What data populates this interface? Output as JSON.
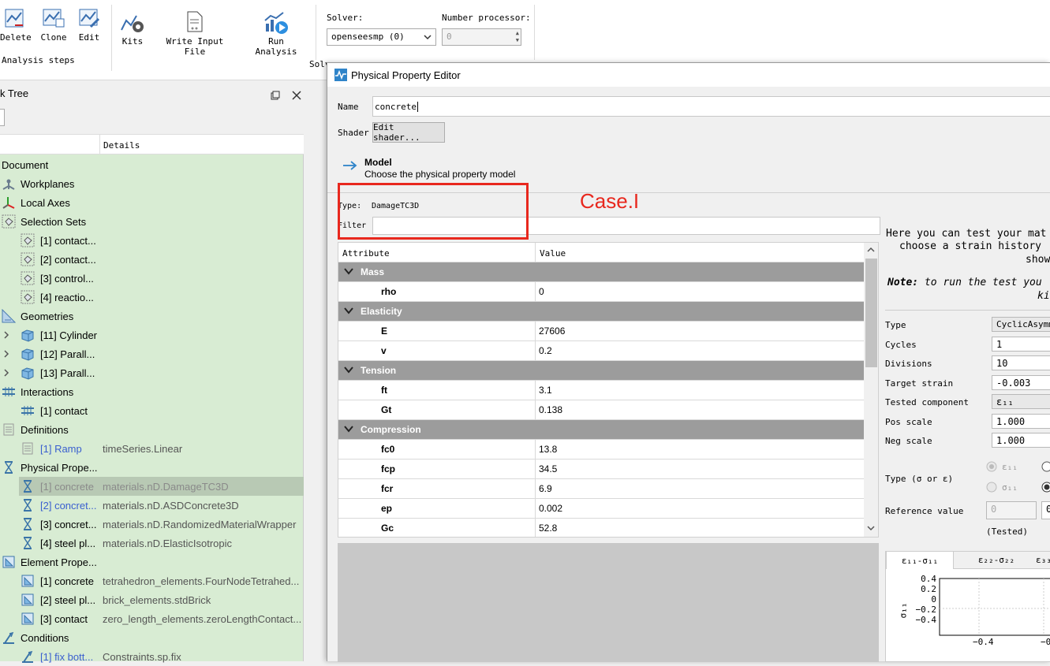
{
  "ribbon": {
    "delete_label": "Delete",
    "clone_label": "Clone",
    "edit_label": "Edit",
    "group_label": "Analysis steps",
    "kits_label": "Kits",
    "write_input_label": "Write Input File",
    "run_analysis_label": "Run Analysis",
    "solver_label": "Solver:",
    "solver_value": "openseesmp (0)",
    "nproc_label": "Number processor:",
    "nproc_value": "0",
    "solver_group_label": "Solv"
  },
  "tree": {
    "title": "k Tree",
    "details_header": "Details",
    "items": [
      {
        "label": "Document",
        "details": ""
      },
      {
        "label": "Workplanes",
        "details": ""
      },
      {
        "label": "Local Axes",
        "details": ""
      },
      {
        "label": "Selection Sets",
        "details": ""
      },
      {
        "label": "[1] contact...",
        "details": ""
      },
      {
        "label": "[2] contact...",
        "details": ""
      },
      {
        "label": "[3] control...",
        "details": ""
      },
      {
        "label": "[4] reactio...",
        "details": ""
      },
      {
        "label": "Geometries",
        "details": ""
      },
      {
        "label": "[11] Cylinder",
        "details": ""
      },
      {
        "label": "[12] Parall...",
        "details": ""
      },
      {
        "label": "[13] Parall...",
        "details": ""
      },
      {
        "label": "Interactions",
        "details": ""
      },
      {
        "label": "[1] contact",
        "details": ""
      },
      {
        "label": "Definitions",
        "details": ""
      },
      {
        "label": "[1] Ramp",
        "details": "timeSeries.Linear"
      },
      {
        "label": "Physical Prope...",
        "details": ""
      },
      {
        "label": "[1] concrete",
        "details": "materials.nD.DamageTC3D"
      },
      {
        "label": "[2] concret...",
        "details": "materials.nD.ASDConcrete3D"
      },
      {
        "label": "[3] concret...",
        "details": "materials.nD.RandomizedMaterialWrapper"
      },
      {
        "label": "[4] steel pl...",
        "details": "materials.nD.ElasticIsotropic"
      },
      {
        "label": "Element Prope...",
        "details": ""
      },
      {
        "label": "[1] concrete",
        "details": "tetrahedron_elements.FourNodeTetrahed..."
      },
      {
        "label": "[2] steel pl...",
        "details": "brick_elements.stdBrick"
      },
      {
        "label": "[3] contact",
        "details": "zero_length_elements.zeroLengthContact..."
      },
      {
        "label": "Conditions",
        "details": ""
      },
      {
        "label": "[1] fix bott...",
        "details": "Constraints.sp.fix"
      }
    ]
  },
  "dialog": {
    "title": "Physical Property Editor",
    "name_label": "Name",
    "name_value": "concrete",
    "shader_label": "Shader",
    "edit_shader_label": "Edit shader...",
    "model_heading": "Model",
    "model_subheading": "Choose the physical property model",
    "type_label": "Type:",
    "type_value": "DamageTC3D",
    "filter_label": "Filter",
    "filter_value": "",
    "annotation": "Case.I",
    "annotation_color": "#e8281e",
    "table": {
      "col_attribute": "Attribute",
      "col_value": "Value",
      "rows": [
        {
          "group": "Mass"
        },
        {
          "key": "rho",
          "value": "0"
        },
        {
          "group": "Elasticity"
        },
        {
          "key": "E",
          "value": "27606"
        },
        {
          "key": "v",
          "value": "0.2"
        },
        {
          "group": "Tension"
        },
        {
          "key": "ft",
          "value": "3.1"
        },
        {
          "key": "Gt",
          "value": "0.138"
        },
        {
          "group": "Compression"
        },
        {
          "key": "fc0",
          "value": "13.8"
        },
        {
          "key": "fcp",
          "value": "34.5"
        },
        {
          "key": "fcr",
          "value": "6.9"
        },
        {
          "key": "ep",
          "value": "0.002"
        },
        {
          "key": "Gc",
          "value": "52.8"
        }
      ]
    },
    "test_panel": {
      "intro_line1": "Here you can test your mat",
      "intro_line2": "choose a strain history",
      "intro_line3": "show",
      "note_bold": "Note:",
      "note_line1": " to run the test you",
      "note_line2": "ki",
      "type_label": "Type",
      "type_value": "CyclicAsymme",
      "cycles_label": "Cycles",
      "cycles_value": "1",
      "divisions_label": "Divisions",
      "divisions_value": "10",
      "target_label": "Target strain",
      "target_value": "-0.003",
      "tested_label": "Tested component",
      "tested_value": "ε₁₁",
      "pos_label": "Pos scale",
      "pos_value": "1.000",
      "neg_label": "Neg scale",
      "neg_value": "1.000",
      "type_se_label": "Type (σ or ε)",
      "radio_eps": "ε₁₁",
      "radio_sig": "σ₁₁",
      "ref_label": "Reference value",
      "ref_value": "0",
      "ref_value2": "0",
      "tested_note": "(Tested)",
      "tabs": [
        "ε₁₁-σ₁₁",
        "ε₂₂-σ₂₂",
        "ε₃₃"
      ],
      "plot_yticks": [
        "0.4",
        "0.2",
        "0",
        "−0.2",
        "−0.4"
      ],
      "plot_xtick": "−0.4",
      "plot_xtick2": "−0",
      "plot_ylabel": "σ₁₁"
    }
  }
}
